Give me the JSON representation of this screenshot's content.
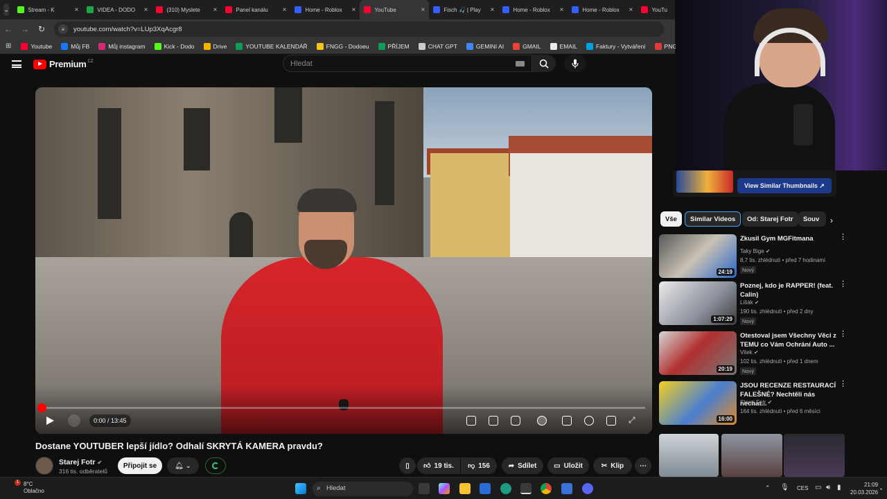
{
  "browser": {
    "tabs": [
      {
        "title": "Stream - K",
        "color": "#53fc18"
      },
      {
        "title": "VIDEA - DODO",
        "color": "#19a843"
      },
      {
        "title": "(310) Myslete",
        "color": "#ff0033"
      },
      {
        "title": "Panel kanálu",
        "color": "#ff0033"
      },
      {
        "title": "Home - Roblox",
        "color": "#335fff"
      },
      {
        "title": "YouTube",
        "color": "#ff0033",
        "active": true
      },
      {
        "title": "Fisch 🎣 | Play",
        "color": "#335fff"
      },
      {
        "title": "Home - Roblox",
        "color": "#335fff"
      },
      {
        "title": "Home - Roblox",
        "color": "#335fff"
      },
      {
        "title": "YouTu",
        "color": "#ff0033"
      }
    ],
    "url": "youtube.com/watch?v=LUp3XqAcgr8",
    "bookmarks": [
      {
        "label": "Youtube",
        "color": "#ff0033"
      },
      {
        "label": "Můj FB",
        "color": "#1877f2"
      },
      {
        "label": "Můj instagram",
        "color": "#d62976"
      },
      {
        "label": "Kick - Dodo",
        "color": "#53fc18"
      },
      {
        "label": "Drive",
        "color": "#f4b400"
      },
      {
        "label": "YOUTUBE KALENDÁŘ",
        "color": "#0f9d58"
      },
      {
        "label": "FNGG - Dodoeu",
        "color": "#f5c518"
      },
      {
        "label": "PŘÍJEM",
        "color": "#0f9d58"
      },
      {
        "label": "CHAT GPT",
        "color": "#cccccc"
      },
      {
        "label": "GEMINI AI",
        "color": "#4285f4"
      },
      {
        "label": "GMAIL",
        "color": "#ea4335"
      },
      {
        "label": "EMAIL",
        "color": "#e8eaed"
      },
      {
        "label": "Faktury - Vytváření",
        "color": "#00a3e0"
      },
      {
        "label": "PNG to PDF",
        "color": "#e53935"
      }
    ]
  },
  "youtube": {
    "logo": "Premium",
    "logo_region": "CZ",
    "search_placeholder": "Hledat"
  },
  "player": {
    "time": "0:00 / 13:45",
    "progress": 0.0
  },
  "video": {
    "title": "Dostane YOUTUBER lepší jídlo? Odhalí SKRYTÁ KAMERA pravdu?",
    "channel": "Starej Fotr",
    "subscribers": "316 tis. odběratelů",
    "join_label": "Připojit se",
    "likes": "19 tis.",
    "dislikes": "156",
    "share_label": "Sdílet",
    "save_label": "Uložit",
    "clip_label": "Klip"
  },
  "sidebar": {
    "similar_thumbnails_label": "View Similar Thumbnails",
    "chips": [
      "Vše",
      "Similar Videos",
      "Od: Starej Fotr",
      "Souv"
    ],
    "recommendations": [
      {
        "title": "Zkusil Gym MGFitmana",
        "channel": "Taky Bige",
        "meta": "8,7 tis. zhlédnutí • před 7 hodinami",
        "badge": "Nový",
        "duration": "24:19"
      },
      {
        "title": "Poznej, kdo je RAPPER! (feat. Calin)",
        "channel": "Lišák",
        "meta": "190 tis. zhlédnutí • před 2 dny",
        "badge": "Nový",
        "duration": "1:07:29"
      },
      {
        "title": "Otestoval jsem Všechny Věci z TEMU co Vám Ochrání Auto ...",
        "channel": "Vitek",
        "meta": "102 tis. zhlédnutí • před 1 dnem",
        "badge": "Nový",
        "duration": "20:19"
      },
      {
        "title": "JSOU RECENZE RESTAURACÍ FALEŠNÉ? Nechtěli nás nechat...",
        "channel": "Starej Fotr",
        "meta": "164 tis. zhlédnutí • před 6 měsíci",
        "badge": "",
        "duration": "16:00"
      }
    ]
  },
  "taskbar": {
    "temperature": "8°C",
    "weather": "Oblačno",
    "notification_count": "1",
    "search_placeholder": "Hledat",
    "language": "CES",
    "time": "21:09",
    "date": "20.03.2026"
  }
}
